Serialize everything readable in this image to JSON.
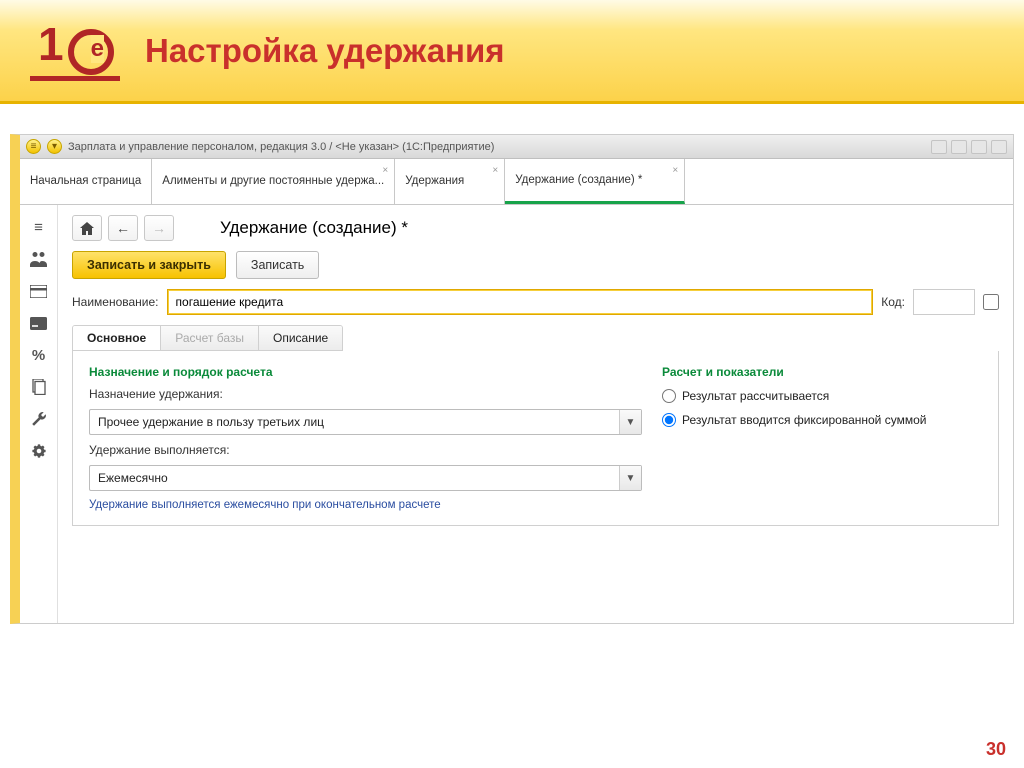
{
  "slide": {
    "title": "Настройка удержания",
    "page_number": "30"
  },
  "app": {
    "title": "Зарплата и управление персоналом, редакция 3.0 / <Не указан>  (1С:Предприятие)",
    "tabs": [
      {
        "label": "Начальная страница",
        "closable": false,
        "active": false
      },
      {
        "label": "Алименты и другие постоянные удержа...",
        "closable": true,
        "active": false
      },
      {
        "label": "Удержания",
        "closable": true,
        "active": false
      },
      {
        "label": "Удержание (создание) *",
        "closable": true,
        "active": true
      }
    ]
  },
  "sidebar_icons": [
    "menu-icon",
    "people-icon",
    "card-icon",
    "payment-icon",
    "percent-icon",
    "documents-icon",
    "wrench-icon",
    "gear-icon"
  ],
  "form": {
    "title": "Удержание (создание) *",
    "btn_save_close": "Записать и закрыть",
    "btn_save": "Записать",
    "name_label": "Наименование:",
    "name_value": "погашение кредита",
    "code_label": "Код:",
    "code_value": "",
    "sub_tabs": [
      {
        "label": "Основное",
        "active": true
      },
      {
        "label": "Расчет базы",
        "dim": true
      },
      {
        "label": "Описание"
      }
    ],
    "left": {
      "section": "Назначение и порядок расчета",
      "purpose_label": "Назначение удержания:",
      "purpose_value": "Прочее удержание в пользу третьих лиц",
      "freq_label": "Удержание выполняется:",
      "freq_value": "Ежемесячно",
      "hint": "Удержание выполняется ежемесячно при окончательном расчете"
    },
    "right": {
      "section": "Расчет и показатели",
      "radio_calc": "Результат рассчитывается",
      "radio_fixed": "Результат вводится фиксированной суммой",
      "selected": "fixed"
    }
  }
}
